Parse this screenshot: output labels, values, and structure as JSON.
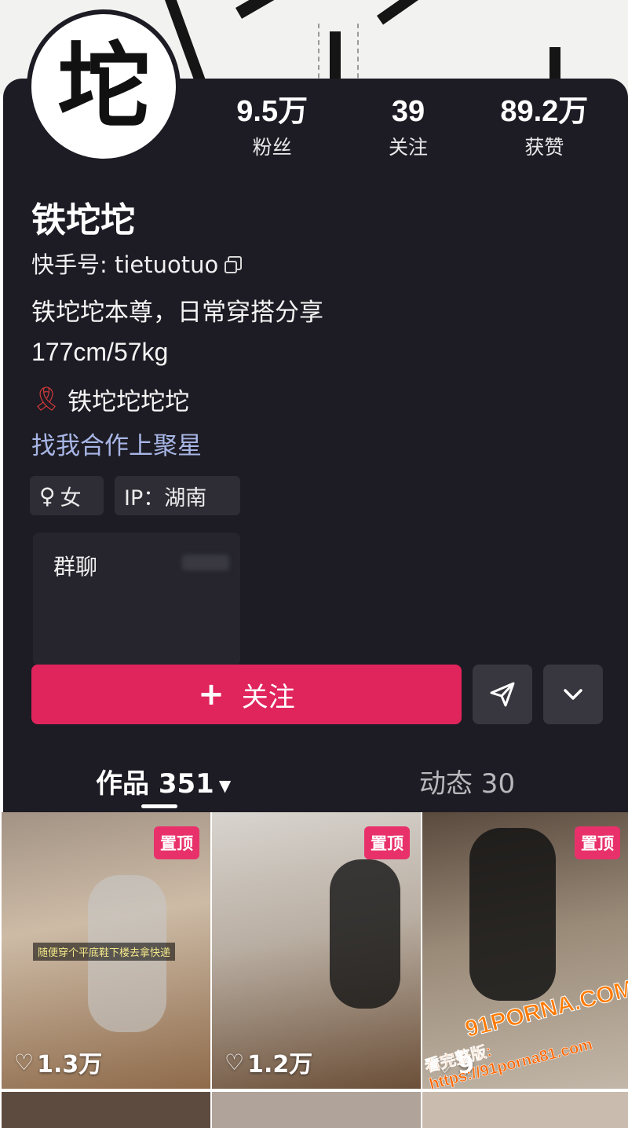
{
  "profile": {
    "avatar_char": "坨",
    "name": "铁坨坨",
    "kuaishou_id": "快手号: tietuotuo",
    "bio_line1": "铁坨坨本尊，日常穿搭分享",
    "bio_line2": "177cm/57kg",
    "bio_line3": "铁坨坨坨坨",
    "collab_link": "找我合作上聚星"
  },
  "stats": [
    {
      "value": "9.5万",
      "label": "粉丝"
    },
    {
      "value": "39",
      "label": "关注"
    },
    {
      "value": "89.2万",
      "label": "获赞"
    }
  ],
  "tags": {
    "gender": "女",
    "ip": "IP：湖南"
  },
  "group_card": {
    "title": "群聊"
  },
  "actions": {
    "follow_label": "关注",
    "follow_plus": "+"
  },
  "tabs": {
    "works": "作品 351",
    "posts": "动态 30"
  },
  "works": [
    {
      "pin": "置顶",
      "likes": "1.3万",
      "caption": "随便穿个平底鞋下楼去拿快递"
    },
    {
      "pin": "置顶",
      "likes": "1.2万"
    },
    {
      "pin": "置顶",
      "likes": "9"
    }
  ],
  "watermark": {
    "logo": "91PORNA.COM",
    "url": "看完整版: https://91porna81.com"
  },
  "colors": {
    "panel_bg": "#1d1c24",
    "follow_button": "#e0245c",
    "collab_link": "#a8b6e6",
    "pin_badge": "#e8316a"
  }
}
